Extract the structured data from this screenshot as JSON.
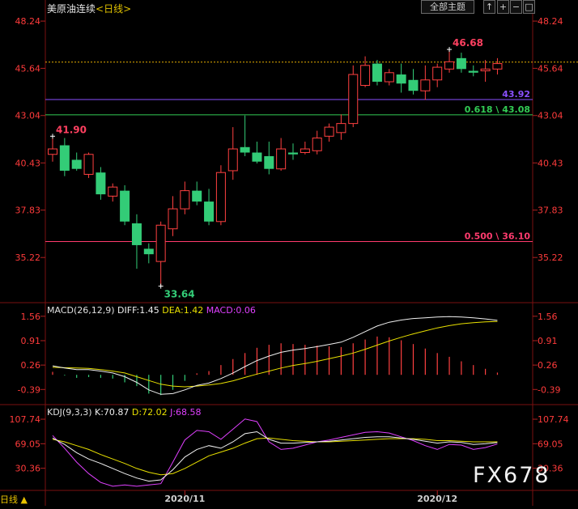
{
  "header": {
    "title": "美原油连续",
    "period": "<日线>",
    "btn_main": "全部主题",
    "btn_up": "↑",
    "btn_zoom_in": "+",
    "btn_zoom_out": "−",
    "btn_box": "□"
  },
  "macd_legend": {
    "label": "MACD(26,12,9)",
    "diff": "DIFF:1.45",
    "dea": "DEA:1.42",
    "macd": "MACD:0.06"
  },
  "kdj_legend": {
    "label": "KDJ(9,3,3)",
    "k": "K:70.87",
    "d": "D:72.02",
    "j": "J:68.58"
  },
  "footer": {
    "period_button": "日线 ▲",
    "watermark": "FX678"
  },
  "colors": {
    "up": "#ff4040",
    "down": "#33cc77",
    "background": "#000000",
    "diff": "#f0f0f0",
    "dea": "#e8e000",
    "kdj_j": "#e040ff"
  },
  "chart_data": [
    {
      "type": "candlestick",
      "ylim": [
        33.0,
        48.6
      ],
      "yticks_left": [
        "48.24",
        "45.64",
        "43.04",
        "40.43",
        "37.83",
        "35.22"
      ],
      "yticks_right": [
        "48.24",
        "45.64",
        "43.04",
        "40.43",
        "37.83",
        "35.22"
      ],
      "xticks": [
        {
          "index": 11,
          "label": "2020/11"
        },
        {
          "index": 32,
          "label": "2020/12"
        }
      ],
      "candles": [
        {
          "o": 40.9,
          "h": 41.9,
          "l": 40.5,
          "c": 41.2
        },
        {
          "o": 41.4,
          "h": 41.8,
          "l": 39.7,
          "c": 40.0
        },
        {
          "o": 40.6,
          "h": 41.0,
          "l": 40.0,
          "c": 40.1
        },
        {
          "o": 39.8,
          "h": 41.0,
          "l": 39.6,
          "c": 40.9
        },
        {
          "o": 39.9,
          "h": 40.2,
          "l": 38.4,
          "c": 38.7
        },
        {
          "o": 38.6,
          "h": 39.3,
          "l": 38.3,
          "c": 39.1
        },
        {
          "o": 38.9,
          "h": 39.2,
          "l": 37.0,
          "c": 37.2
        },
        {
          "o": 37.1,
          "h": 37.6,
          "l": 34.6,
          "c": 35.9
        },
        {
          "o": 35.7,
          "h": 36.0,
          "l": 34.9,
          "c": 35.4
        },
        {
          "o": 35.0,
          "h": 37.2,
          "l": 33.64,
          "c": 37.0
        },
        {
          "o": 36.8,
          "h": 38.6,
          "l": 36.4,
          "c": 37.9
        },
        {
          "o": 37.9,
          "h": 39.4,
          "l": 37.6,
          "c": 38.9
        },
        {
          "o": 38.9,
          "h": 39.4,
          "l": 38.1,
          "c": 38.3
        },
        {
          "o": 38.3,
          "h": 39.0,
          "l": 37.0,
          "c": 37.2
        },
        {
          "o": 37.2,
          "h": 40.3,
          "l": 37.0,
          "c": 39.9
        },
        {
          "o": 40.0,
          "h": 42.4,
          "l": 39.5,
          "c": 41.2
        },
        {
          "o": 41.3,
          "h": 43.04,
          "l": 40.8,
          "c": 41.0
        },
        {
          "o": 41.0,
          "h": 41.6,
          "l": 40.4,
          "c": 40.5
        },
        {
          "o": 40.8,
          "h": 41.6,
          "l": 39.8,
          "c": 40.1
        },
        {
          "o": 40.1,
          "h": 41.8,
          "l": 40.0,
          "c": 41.2
        },
        {
          "o": 41.0,
          "h": 41.5,
          "l": 40.6,
          "c": 40.9
        },
        {
          "o": 41.0,
          "h": 41.6,
          "l": 40.9,
          "c": 41.2
        },
        {
          "o": 41.1,
          "h": 42.2,
          "l": 40.9,
          "c": 41.8
        },
        {
          "o": 41.9,
          "h": 42.6,
          "l": 41.6,
          "c": 42.4
        },
        {
          "o": 42.1,
          "h": 43.1,
          "l": 41.7,
          "c": 42.6
        },
        {
          "o": 42.6,
          "h": 45.8,
          "l": 42.4,
          "c": 45.3
        },
        {
          "o": 44.7,
          "h": 46.3,
          "l": 44.6,
          "c": 45.8
        },
        {
          "o": 45.9,
          "h": 46.1,
          "l": 44.7,
          "c": 44.9
        },
        {
          "o": 44.9,
          "h": 45.6,
          "l": 44.7,
          "c": 45.4
        },
        {
          "o": 45.3,
          "h": 45.9,
          "l": 44.3,
          "c": 44.8
        },
        {
          "o": 45.0,
          "h": 45.6,
          "l": 44.2,
          "c": 44.4
        },
        {
          "o": 44.4,
          "h": 45.8,
          "l": 43.9,
          "c": 45.0
        },
        {
          "o": 45.0,
          "h": 45.9,
          "l": 44.6,
          "c": 45.7
        },
        {
          "o": 45.6,
          "h": 46.68,
          "l": 45.4,
          "c": 46.0
        },
        {
          "o": 46.2,
          "h": 46.5,
          "l": 45.4,
          "c": 45.6
        },
        {
          "o": 45.5,
          "h": 45.8,
          "l": 45.2,
          "c": 45.4
        },
        {
          "o": 45.5,
          "h": 46.1,
          "l": 44.9,
          "c": 45.6
        },
        {
          "o": 45.6,
          "h": 46.2,
          "l": 45.3,
          "c": 45.9
        }
      ],
      "annotations": [
        {
          "label": "41.90",
          "index": 0,
          "value": 41.9,
          "color": "#ff4060"
        },
        {
          "label": "33.64",
          "index": 9,
          "value": 33.64,
          "color": "#33cc77"
        },
        {
          "label": "46.68",
          "index": 33,
          "value": 46.68,
          "color": "#ff4060"
        }
      ],
      "levels": [
        {
          "value": 45.98,
          "color": "#e8b000",
          "style": "dotted",
          "label": ""
        },
        {
          "value": 43.92,
          "color": "#8a50ff",
          "style": "solid",
          "label": "43.92"
        },
        {
          "value": 43.08,
          "color": "#33cc55",
          "style": "solid",
          "label": "0.618 \\ 43.08"
        },
        {
          "value": 36.1,
          "color": "#ff3b6e",
          "style": "solid",
          "label": "0.500 \\ 36.10"
        }
      ]
    },
    {
      "type": "macd",
      "ylim": [
        -0.75,
        1.75
      ],
      "yticks_left": [
        "1.56",
        "0.91",
        "0.26",
        "-0.39"
      ],
      "yticks_right": [
        "1.56",
        "0.91",
        "0.26",
        "-0.39"
      ],
      "diff": [
        0.24,
        0.18,
        0.14,
        0.14,
        0.1,
        0.05,
        -0.05,
        -0.2,
        -0.4,
        -0.52,
        -0.5,
        -0.4,
        -0.28,
        -0.22,
        -0.1,
        0.05,
        0.22,
        0.38,
        0.5,
        0.6,
        0.66,
        0.7,
        0.75,
        0.81,
        0.87,
        1.0,
        1.15,
        1.3,
        1.4,
        1.46,
        1.5,
        1.52,
        1.54,
        1.55,
        1.54,
        1.52,
        1.49,
        1.45
      ],
      "dea": [
        0.2,
        0.19,
        0.18,
        0.17,
        0.14,
        0.1,
        0.05,
        -0.05,
        -0.15,
        -0.25,
        -0.3,
        -0.32,
        -0.3,
        -0.27,
        -0.23,
        -0.16,
        -0.07,
        0.02,
        0.1,
        0.18,
        0.25,
        0.3,
        0.36,
        0.43,
        0.5,
        0.58,
        0.68,
        0.79,
        0.9,
        1.0,
        1.09,
        1.17,
        1.25,
        1.31,
        1.36,
        1.39,
        1.41,
        1.42
      ],
      "macd": [
        0.08,
        -0.02,
        -0.08,
        -0.06,
        -0.08,
        -0.1,
        -0.2,
        -0.3,
        -0.5,
        -0.54,
        -0.4,
        -0.16,
        0.04,
        0.1,
        0.26,
        0.42,
        0.58,
        0.72,
        0.8,
        0.84,
        0.82,
        0.8,
        0.78,
        0.76,
        0.74,
        0.84,
        0.94,
        1.02,
        1.0,
        0.92,
        0.82,
        0.7,
        0.58,
        0.48,
        0.36,
        0.26,
        0.16,
        0.06
      ]
    },
    {
      "type": "kdj",
      "ylim": [
        -2,
        118
      ],
      "yticks_left": [
        "107.74",
        "69.05",
        "30.36"
      ],
      "yticks_right": [
        "107.74",
        "69.05",
        "30.36"
      ],
      "k": [
        78,
        68,
        55,
        45,
        38,
        30,
        22,
        15,
        10,
        12,
        28,
        48,
        60,
        66,
        62,
        72,
        85,
        88,
        76,
        70,
        70,
        71,
        72,
        73,
        75,
        77,
        79,
        80,
        80,
        78,
        76,
        73,
        70,
        72,
        71,
        68,
        69,
        70.87
      ],
      "d": [
        76,
        72,
        66,
        60,
        52,
        45,
        38,
        30,
        24,
        20,
        22,
        30,
        40,
        50,
        56,
        62,
        70,
        77,
        78,
        76,
        74,
        73,
        72,
        72,
        73,
        74,
        75,
        76,
        77,
        77,
        77,
        76,
        74,
        74,
        73,
        72,
        72,
        72.02
      ],
      "j": [
        82,
        62,
        40,
        22,
        8,
        2,
        4,
        2,
        4,
        6,
        40,
        75,
        90,
        88,
        76,
        92,
        108,
        104,
        72,
        60,
        62,
        67,
        72,
        75,
        79,
        83,
        87,
        88,
        86,
        80,
        74,
        66,
        60,
        68,
        67,
        60,
        63,
        68.58
      ]
    }
  ]
}
